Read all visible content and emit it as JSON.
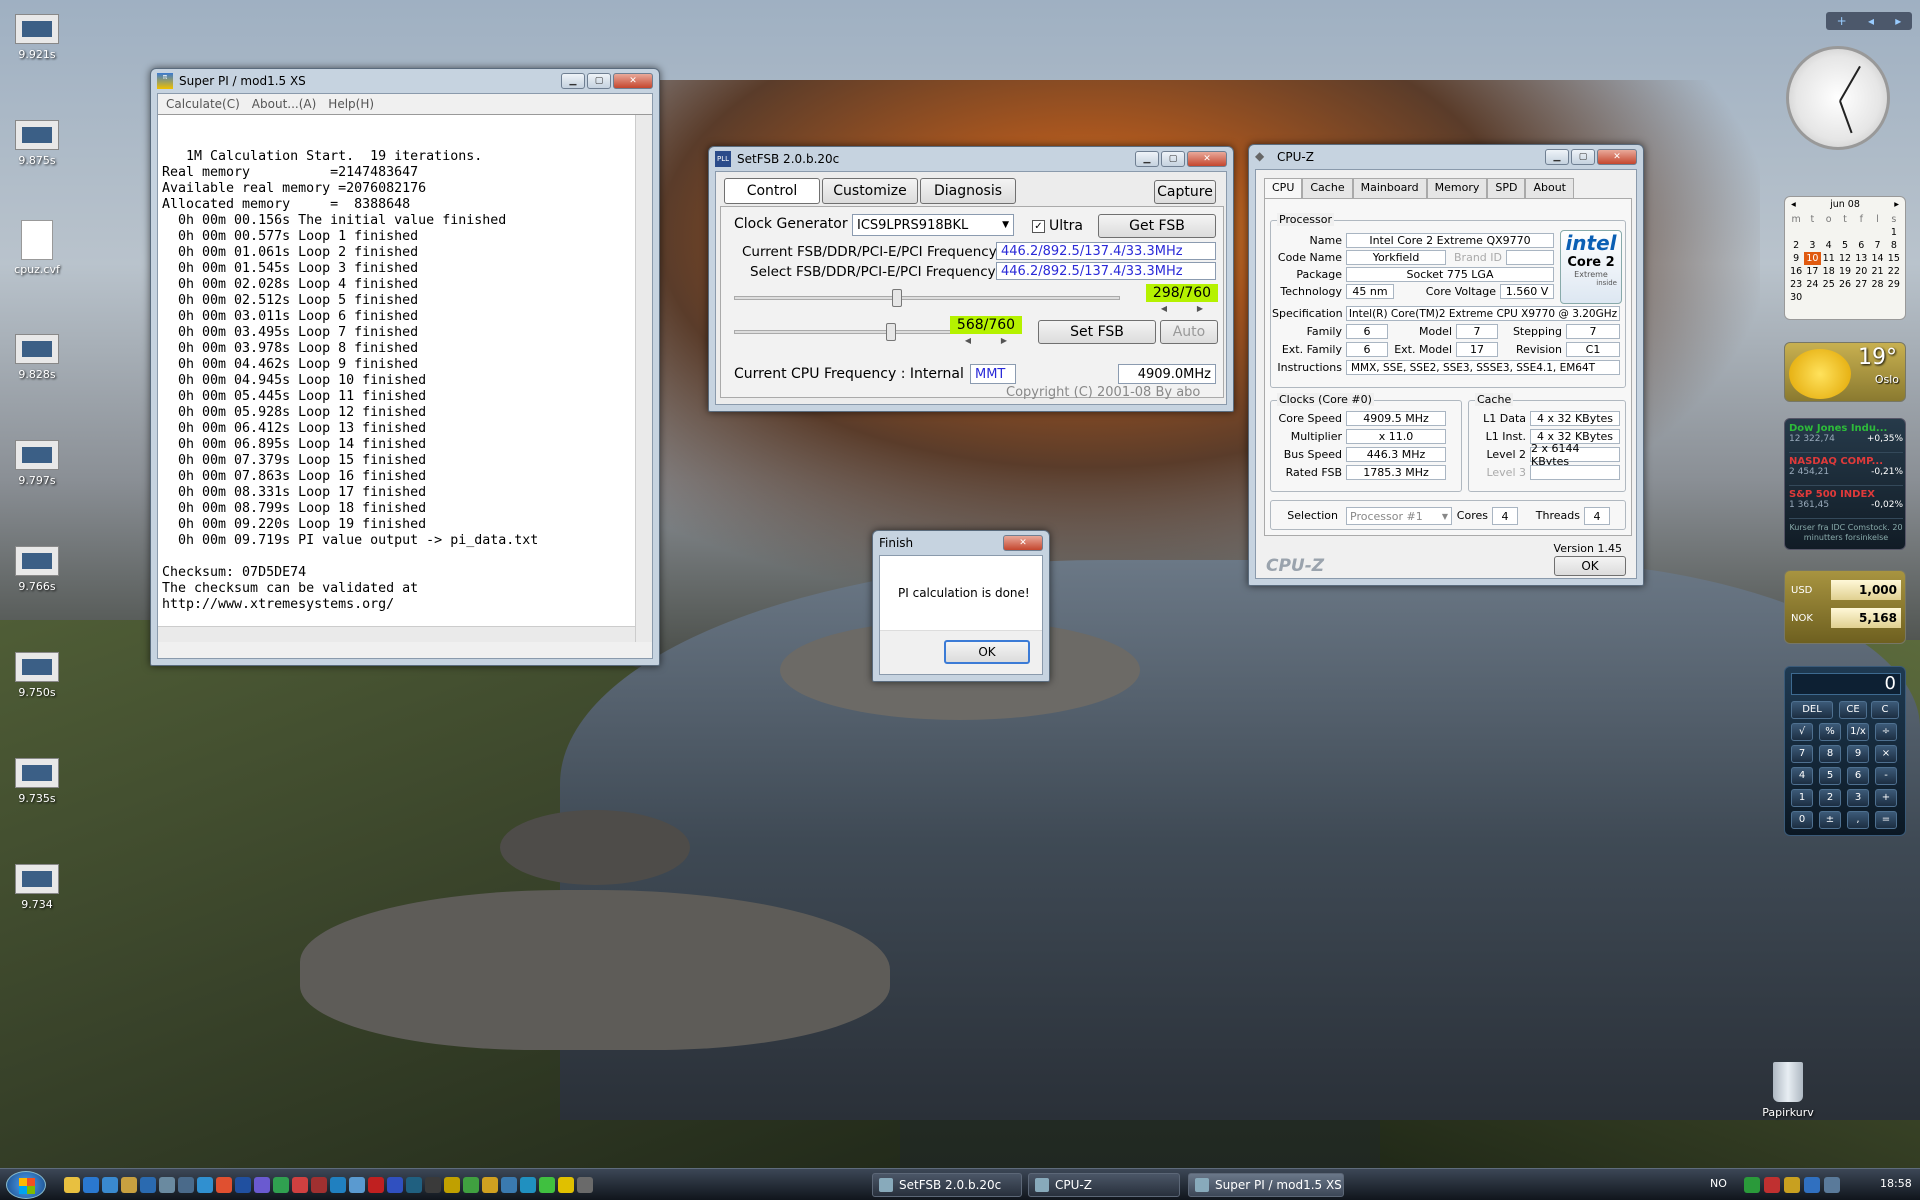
{
  "desktop": {
    "icons": [
      {
        "label": "9.921s"
      },
      {
        "label": "9.875s"
      },
      {
        "label": "cpuz.cvf"
      },
      {
        "label": "9.828s"
      },
      {
        "label": "9.797s"
      },
      {
        "label": "9.766s"
      },
      {
        "label": "9.750s"
      },
      {
        "label": "9.735s"
      },
      {
        "label": "9.734"
      }
    ],
    "recycle_bin": "Papirkurv"
  },
  "superpi": {
    "title": "Super PI / mod1.5 XS",
    "menu": [
      "Calculate(C)",
      "About...(A)",
      "Help(H)"
    ],
    "output": [
      "   1M Calculation Start.  19 iterations.",
      "Real memory          =2147483647",
      "Available real memory =2076082176",
      "Allocated memory     =  8388648",
      "  0h 00m 00.156s The initial value finished",
      "  0h 00m 00.577s Loop 1 finished",
      "  0h 00m 01.061s Loop 2 finished",
      "  0h 00m 01.545s Loop 3 finished",
      "  0h 00m 02.028s Loop 4 finished",
      "  0h 00m 02.512s Loop 5 finished",
      "  0h 00m 03.011s Loop 6 finished",
      "  0h 00m 03.495s Loop 7 finished",
      "  0h 00m 03.978s Loop 8 finished",
      "  0h 00m 04.462s Loop 9 finished",
      "  0h 00m 04.945s Loop 10 finished",
      "  0h 00m 05.445s Loop 11 finished",
      "  0h 00m 05.928s Loop 12 finished",
      "  0h 00m 06.412s Loop 13 finished",
      "  0h 00m 06.895s Loop 14 finished",
      "  0h 00m 07.379s Loop 15 finished",
      "  0h 00m 07.863s Loop 16 finished",
      "  0h 00m 08.331s Loop 17 finished",
      "  0h 00m 08.799s Loop 18 finished",
      "  0h 00m 09.220s Loop 19 finished",
      "  0h 00m 09.719s PI value output -> pi_data.txt",
      "",
      "Checksum: 07D5DE74",
      "The checksum can be validated at",
      "http://www.xtremesystems.org/"
    ]
  },
  "setfsb": {
    "title": "SetFSB 2.0.b.20c",
    "tabs": [
      "Control",
      "Customize",
      "Diagnosis"
    ],
    "capture": "Capture",
    "clock_gen_label": "Clock Generator",
    "clock_gen_value": "ICS9LPRS918BKL",
    "ultra": "Ultra",
    "get_fsb": "Get FSB",
    "current_label": "Current FSB/DDR/PCI-E/PCI Frequency",
    "current_value": "446.2/892.5/137.4/33.3MHz",
    "select_label": "Select FSB/DDR/PCI-E/PCI Frequency",
    "select_value": "446.2/892.5/137.4/33.3MHz",
    "slider1_value": "298/760",
    "slider2_value": "568/760",
    "set_fsb": "Set FSB",
    "auto": "Auto",
    "cpu_freq_label": "Current CPU Frequency : Internal",
    "timer": "MMT",
    "cpu_freq_value": "4909.0MHz",
    "copyright": "Copyright (C) 2001-08 By abo"
  },
  "finish": {
    "title": "Finish",
    "message": "PI calculation is done!",
    "ok": "OK"
  },
  "cpuz": {
    "title": "CPU-Z",
    "tabs": [
      "CPU",
      "Cache",
      "Mainboard",
      "Memory",
      "SPD",
      "About"
    ],
    "processor_group": "Processor",
    "name_label": "Name",
    "name": "Intel Core 2 Extreme QX9770",
    "code_label": "Code Name",
    "code": "Yorkfield",
    "brand_label": "Brand ID",
    "package_label": "Package",
    "package": "Socket 775 LGA",
    "tech_label": "Technology",
    "tech": "45 nm",
    "voltage_label": "Core Voltage",
    "voltage": "1.560 V",
    "spec_label": "Specification",
    "spec": "Intel(R) Core(TM)2 Extreme CPU X9770  @ 3.20GHz",
    "family_label": "Family",
    "family": "6",
    "model_label": "Model",
    "model": "7",
    "stepping_label": "Stepping",
    "stepping": "7",
    "extfam_label": "Ext. Family",
    "extfam": "6",
    "extmodel_label": "Ext. Model",
    "extmodel": "17",
    "revision_label": "Revision",
    "revision": "C1",
    "instr_label": "Instructions",
    "instr": "MMX, SSE, SSE2, SSE3, SSSE3, SSE4.1, EM64T",
    "clocks_group": "Clocks (Core #0)",
    "core_speed_label": "Core Speed",
    "core_speed": "4909.5 MHz",
    "mult_label": "Multiplier",
    "mult": "x 11.0",
    "bus_label": "Bus Speed",
    "bus": "446.3 MHz",
    "rated_label": "Rated FSB",
    "rated": "1785.3 MHz",
    "cache_group": "Cache",
    "l1d_label": "L1 Data",
    "l1d": "4 x 32 KBytes",
    "l1i_label": "L1 Inst.",
    "l1i": "4 x 32 KBytes",
    "l2_label": "Level 2",
    "l2": "2 x 6144 KBytes",
    "l3_label": "Level 3",
    "selection_label": "Selection",
    "selection": "Processor #1",
    "cores_label": "Cores",
    "cores": "4",
    "threads_label": "Threads",
    "threads": "4",
    "version": "Version 1.45",
    "brand_footer": "CPU-Z",
    "ok": "OK",
    "logo": {
      "line1": "intel",
      "line2": "Core 2",
      "line3": "Extreme",
      "line4": "inside"
    }
  },
  "gadgets": {
    "calendar_month": "jun 08",
    "calendar_days": [
      "m",
      "t",
      "o",
      "t",
      "f",
      "l",
      "s"
    ],
    "calendar_dates": [
      "",
      "",
      "",
      "",
      "",
      "",
      "1",
      "2",
      "3",
      "4",
      "5",
      "6",
      "7",
      "8",
      "9",
      "10",
      "11",
      "12",
      "13",
      "14",
      "15",
      "16",
      "17",
      "18",
      "19",
      "20",
      "21",
      "22",
      "23",
      "24",
      "25",
      "26",
      "27",
      "28",
      "29",
      "30"
    ],
    "weather_temp": "19°",
    "weather_city": "Oslo",
    "stocks": [
      {
        "name": "Dow Jones Indu...",
        "value": "12 322,74",
        "change": "+0,35%",
        "color": "#2dbb3a"
      },
      {
        "name": "NASDAQ COMP...",
        "value": "2 454,21",
        "change": "-0,21%",
        "color": "#e03a3a"
      },
      {
        "name": "S&P 500 INDEX",
        "value": "1 361,45",
        "change": "-0,02%",
        "color": "#e03a3a"
      }
    ],
    "stocks_note": "Kurser fra IDC Comstock. 20 minutters forsinkelse",
    "currency": [
      {
        "code": "USD",
        "value": "1,000"
      },
      {
        "code": "NOK",
        "value": "5,168"
      }
    ],
    "calc_display": "0",
    "calc_keys": [
      [
        "DEL",
        "CE",
        "C"
      ],
      [
        "√",
        "%",
        "1/x",
        "÷"
      ],
      [
        "7",
        "8",
        "9",
        "×"
      ],
      [
        "4",
        "5",
        "6",
        "-"
      ],
      [
        "1",
        "2",
        "3",
        "+"
      ],
      [
        "0",
        "±",
        ",",
        "="
      ]
    ]
  },
  "taskbar": {
    "tasks": [
      {
        "label": "SetFSB 2.0.b.20c"
      },
      {
        "label": "CPU-Z"
      },
      {
        "label": "Super PI / mod1.5 XS"
      }
    ],
    "lang": "NO",
    "time": "18:58"
  }
}
